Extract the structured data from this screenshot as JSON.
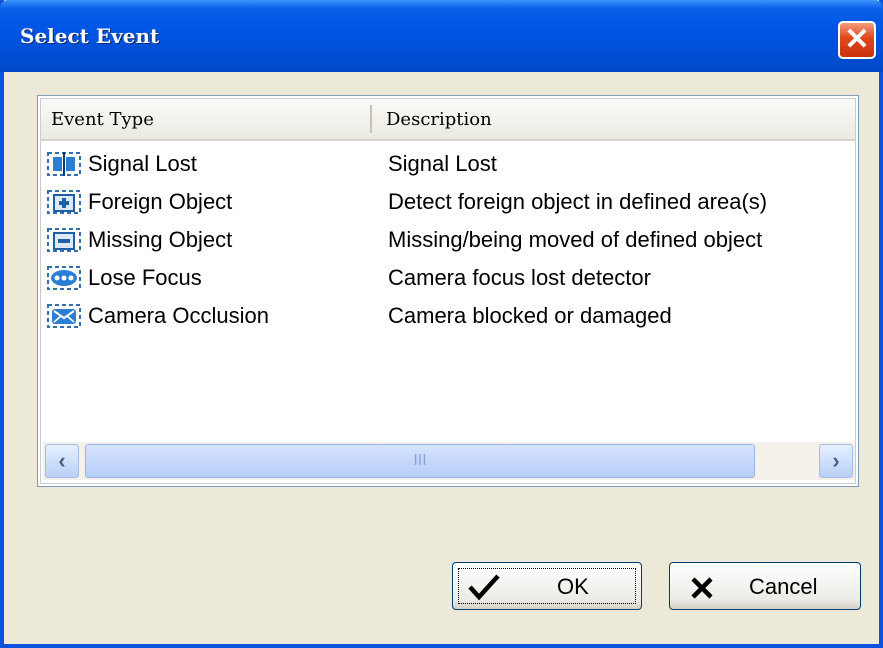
{
  "dialog": {
    "title": "Select Event"
  },
  "listview": {
    "columns": [
      "Event Type",
      "Description"
    ],
    "rows": [
      {
        "icon": "signal-lost-icon",
        "type": "Signal Lost",
        "description": "Signal Lost"
      },
      {
        "icon": "foreign-object-icon",
        "type": "Foreign Object",
        "description": "Detect foreign object in defined area(s)"
      },
      {
        "icon": "missing-object-icon",
        "type": "Missing Object",
        "description": "Missing/being moved of defined object"
      },
      {
        "icon": "lose-focus-icon",
        "type": "Lose Focus",
        "description": "Camera focus lost detector"
      },
      {
        "icon": "camera-occlusion-icon",
        "type": "Camera Occlusion",
        "description": "Camera blocked or damaged"
      }
    ],
    "scrollbar_thumb_grip": "III"
  },
  "buttons": {
    "ok": "OK",
    "cancel": "Cancel"
  },
  "colors": {
    "titlebar": "#0055e5",
    "close": "#e0461b",
    "face": "#ece9d8"
  }
}
